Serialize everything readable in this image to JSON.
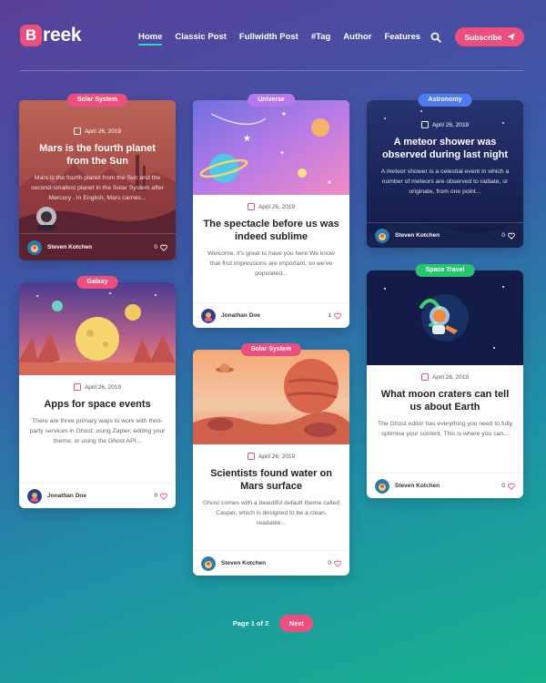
{
  "logo": {
    "initial": "B",
    "rest": "reek"
  },
  "nav": {
    "items": [
      "Home",
      "Classic Post",
      "Fullwidth Post",
      "#Tag",
      "Author",
      "Features"
    ],
    "subscribe": "Subscribe"
  },
  "colors": {
    "accent": "#ec4f7d",
    "active_underline": "#2fd4c5"
  },
  "cards": [
    {
      "tag": "Solar System",
      "tag_color": "#ec4f7d",
      "date": "April 26, 2019",
      "title": "Mars is the fourth planet from the Sun",
      "excerpt": "Mars is the fourth planet from the Sun and the second-smallest planet in the Solar System after Mercury . In English, Mars carries...",
      "author": "Steven Kotchen",
      "likes": "0"
    },
    {
      "tag": "Galaxy",
      "tag_color": "#ec4f7d",
      "date": "April 26, 2019",
      "title": "Apps for space events",
      "excerpt": "There are three primary ways to work with third-party services in Ghost: using Zapier, editing your theme, or using the Ghost API...",
      "author": "Jonathan Doe",
      "likes": "0"
    },
    {
      "tag": "Universe",
      "tag_color": "#b678e8",
      "date": "April 26, 2019",
      "title": "The spectacle before us was indeed sublime",
      "excerpt": "Welcome, it's great to have you here.We know that first impressions are important, so we've populated...",
      "author": "Jonathan Doe",
      "likes": "1"
    },
    {
      "tag": "Solar System",
      "tag_color": "#ec4f7d",
      "date": "April 26, 2019",
      "title": "Scientists found water on Mars surface",
      "excerpt": "Ghost comes with a beautiful default theme called Casper, which is designed to be a clean, readable...",
      "author": "Steven Kotchen",
      "likes": "0"
    },
    {
      "tag": "Astronomy",
      "tag_color": "#4d7cf0",
      "date": "April 26, 2019",
      "title": "A meteor shower was observed during last night",
      "excerpt": "A meteor shower is a celestial event in which a number of meteors are observed to radiate, or originate, from one point...",
      "author": "Steven Kotchen",
      "likes": "0"
    },
    {
      "tag": "Space Travel",
      "tag_color": "#26c46e",
      "date": "April 26, 2019",
      "title": "What moon craters can tell us about Earth",
      "excerpt": "The Ghost editor has everything you need to fully optimise your content. This is where you can...",
      "author": "Steven Kotchen",
      "likes": "0"
    }
  ],
  "pagination": {
    "label": "Page 1 of 2",
    "next": "Next"
  }
}
